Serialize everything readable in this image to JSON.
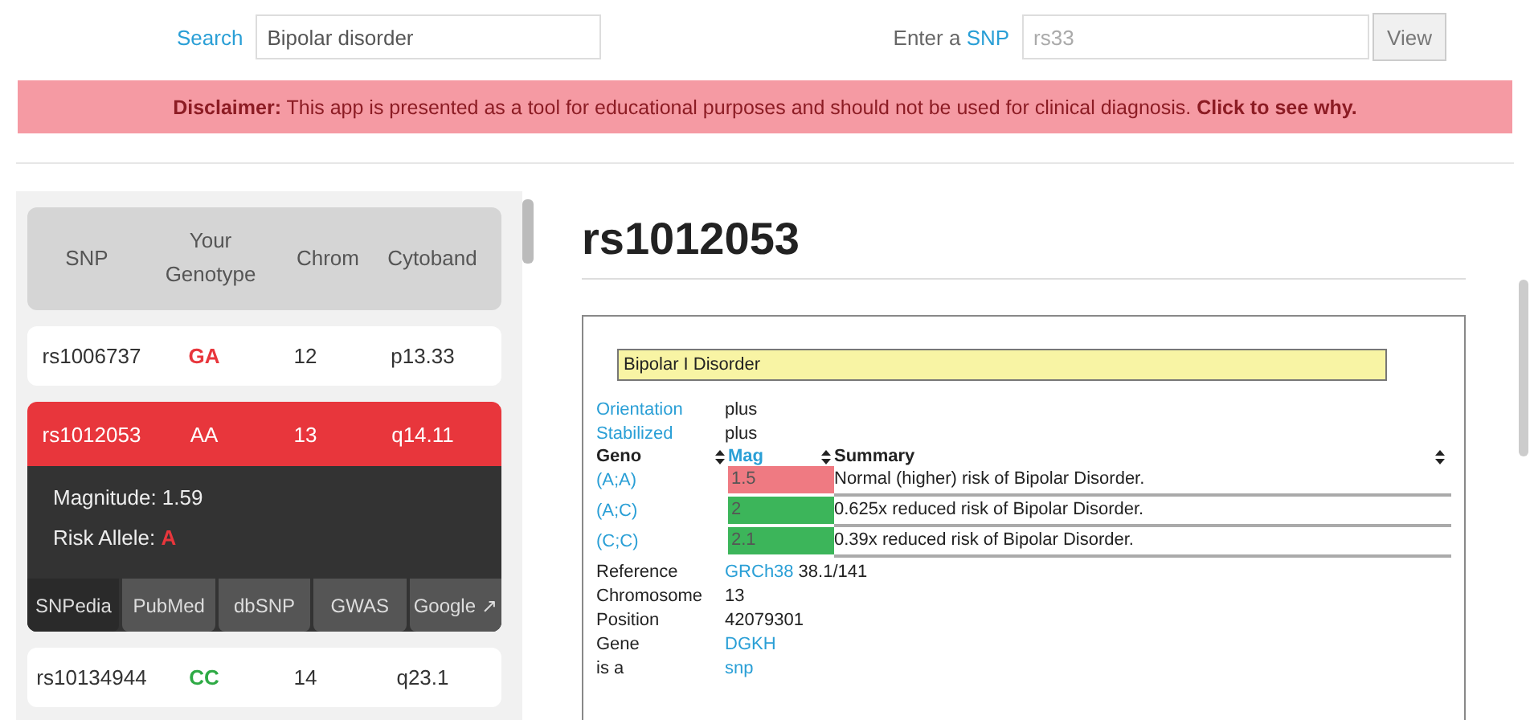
{
  "search": {
    "label": "Search",
    "value": "Bipolar disorder"
  },
  "snp_lookup": {
    "label_prefix": "Enter a",
    "label_link": "SNP",
    "placeholder": "rs33",
    "button": "View"
  },
  "disclaimer": {
    "lead": "Disclaimer:",
    "text": "This app is presented as a tool for educational purposes and should not be used for clinical diagnosis.",
    "link": "Click to see why."
  },
  "snp_table": {
    "columns": [
      "SNP",
      "Your Genotype",
      "Chrom",
      "Cytoband"
    ],
    "rows": [
      {
        "snp": "rs1006737",
        "genotype": "GA",
        "color": "#e8363c",
        "chrom": "12",
        "cytoband": "p13.33",
        "selected": false
      },
      {
        "snp": "rs1012053",
        "genotype": "AA",
        "color": "#ffffff",
        "chrom": "13",
        "cytoband": "q14.11",
        "selected": true,
        "details": {
          "magnitude": "Magnitude: 1.59",
          "risk_label": "Risk Allele:",
          "risk_allele": "A"
        },
        "links": [
          {
            "label": "SNPedia",
            "selected": true
          },
          {
            "label": "PubMed",
            "selected": false
          },
          {
            "label": "dbSNP",
            "selected": false
          },
          {
            "label": "GWAS",
            "selected": false
          },
          {
            "label": "Google ↗",
            "selected": false
          }
        ]
      },
      {
        "snp": "rs10134944",
        "genotype": "CC",
        "color": "#2eaa45",
        "chrom": "14",
        "cytoband": "q23.1",
        "selected": false
      }
    ]
  },
  "detail": {
    "title": "rs1012053",
    "trait": "Bipolar I Disorder",
    "props_top": [
      {
        "key": "Orientation",
        "value": "plus"
      },
      {
        "key": "Stabilized",
        "value": "plus"
      }
    ],
    "geno_columns": [
      "Geno",
      "Mag",
      "Summary"
    ],
    "genotypes": [
      {
        "geno": "(A;A)",
        "mag": "1.5",
        "color": "#ef7a82",
        "summary": "Normal (higher) risk of Bipolar Disorder."
      },
      {
        "geno": "(A;C)",
        "mag": "2",
        "color": "#3cb55a",
        "summary": "0.625x reduced risk of Bipolar Disorder."
      },
      {
        "geno": "(C;C)",
        "mag": "2.1",
        "color": "#3cb55a",
        "summary": "0.39x reduced risk of Bipolar Disorder."
      }
    ],
    "props_bottom": [
      {
        "key": "Reference",
        "link": "GRCh38",
        "value": "38.1/141"
      },
      {
        "key": "Chromosome",
        "value": "13"
      },
      {
        "key": "Position",
        "value": "42079301"
      },
      {
        "key": "Gene",
        "link": "DGKH"
      },
      {
        "key": "is a",
        "link": "snp"
      }
    ]
  }
}
